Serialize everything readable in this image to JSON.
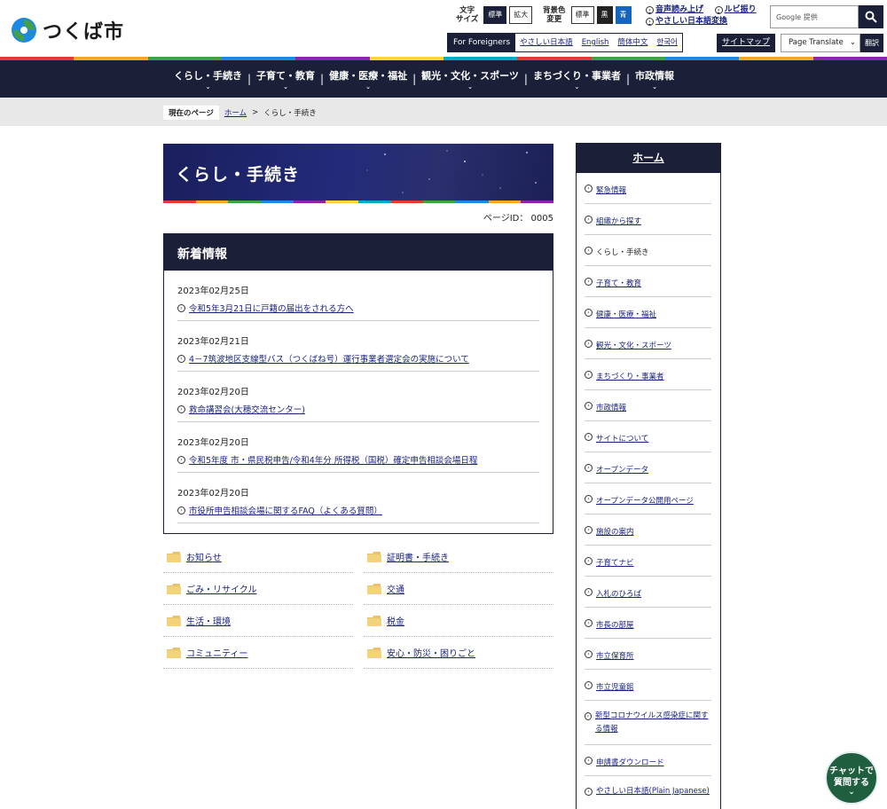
{
  "site": {
    "name": "つくば市"
  },
  "header": {
    "text_size": {
      "label": "文字サイズ",
      "options": [
        "標準",
        "拡大"
      ]
    },
    "bg_color": {
      "label": "背景色変更",
      "options": [
        "標準",
        "黒",
        "青"
      ]
    },
    "a11y": {
      "read_aloud": "音声読み上げ",
      "ruby": "ルビ振り",
      "easy_japanese": "やさしい日本語変換"
    },
    "search": {
      "placeholder": "Google 提供"
    },
    "languages": {
      "label": "For Foreigners",
      "items": [
        "やさしい日本語",
        "English",
        "簡体中文",
        "한국어"
      ]
    },
    "sitemap": "サイトマップ",
    "translate": {
      "label": "Page Translate",
      "go": "翻訳"
    }
  },
  "colors": {
    "navy": "#1b2038",
    "accent_blue": "#1565c0",
    "chat_green": "#1f5e3f",
    "strip": [
      "#e53935",
      "#f5a623",
      "#43a047",
      "#1e88e5",
      "#8e24aa",
      "#fdd835",
      "#00acc1",
      "#e53935",
      "#43a047",
      "#1e88e5",
      "#f5a623",
      "#8e24aa"
    ]
  },
  "gnav": {
    "items": [
      "くらし・手続き",
      "子育て・教育",
      "健康・医療・福祉",
      "観光・文化・スポーツ",
      "まちづくり・事業者",
      "市政情報"
    ],
    "chevron": "⌄"
  },
  "breadcrumb": {
    "tag": "現在のページ",
    "home": "ホーム",
    "sep": ">",
    "current": "くらし・手続き"
  },
  "page": {
    "title": "くらし・手続き",
    "page_id": "ページID： 0005"
  },
  "news": {
    "heading": "新着情報",
    "items": [
      {
        "date": "2023年02月25日",
        "title": "令和5年3月21日に戸籍の届出をされる方へ"
      },
      {
        "date": "2023年02月21日",
        "title": "4－7筑波地区支線型バス（つくばね号）運行事業者選定会の実施について"
      },
      {
        "date": "2023年02月20日",
        "title": "救命講習会(大穂交流センター)"
      },
      {
        "date": "2023年02月20日",
        "title": "令和5年度 市・県民税申告/令和4年分 所得税（国税）確定申告相談会場日程"
      },
      {
        "date": "2023年02月20日",
        "title": "市役所申告相談会場に関するFAQ（よくある質問）"
      }
    ]
  },
  "categories": [
    "お知らせ",
    "証明書・手続き",
    "ごみ・リサイクル",
    "交通",
    "生活・環境",
    "税金",
    "コミュニティー",
    "安心・防災・困りごと"
  ],
  "sidebar": {
    "heading": "ホーム",
    "items": [
      "緊急情報",
      "組織から探す",
      "くらし・手続き",
      "子育て・教育",
      "健康・医療・福祉",
      "観光・文化・スポーツ",
      "まちづくり・事業者",
      "市政情報",
      "サイトについて",
      "オープンデータ",
      "オープンデータ公開用ページ",
      "施設の案内",
      "子育てナビ",
      "入札のひろば",
      "市長の部屋",
      "市立保育所",
      "市立児童館",
      "新型コロナウイルス感染症に関する情報",
      "申請書ダウンロード",
      "やさしい日本語(Plain Japanese)"
    ]
  },
  "chat": {
    "label_line1": "チャットで",
    "label_line2": "質問する"
  }
}
